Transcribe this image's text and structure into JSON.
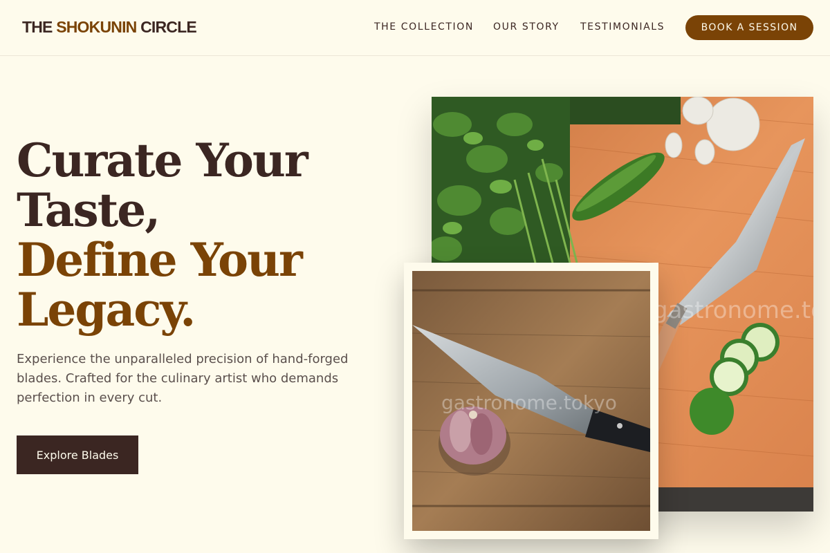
{
  "nav": {
    "logo_part1": "THE ",
    "logo_accent": "SHOKUNIN",
    "logo_part2": " CIRCLE",
    "links": [
      "THE COLLECTION",
      "OUR STORY",
      "TESTIMONIALS"
    ],
    "cta": "BOOK A SESSION"
  },
  "hero": {
    "line1": "Curate Your",
    "line2": "Taste,",
    "line3": "Define Your",
    "line4": "Legacy.",
    "subtitle": "Experience the unparalleled precision of hand-forged blades. Crafted for the culinary artist who demands perfection in every cut.",
    "button": "Explore Blades"
  },
  "images": {
    "main_watermark": "gastronome.tokyo",
    "small_watermark": "gastronome.tokyo"
  },
  "colors": {
    "background": "#fefbec",
    "dark": "#3b2622",
    "accent": "#7a4306"
  }
}
